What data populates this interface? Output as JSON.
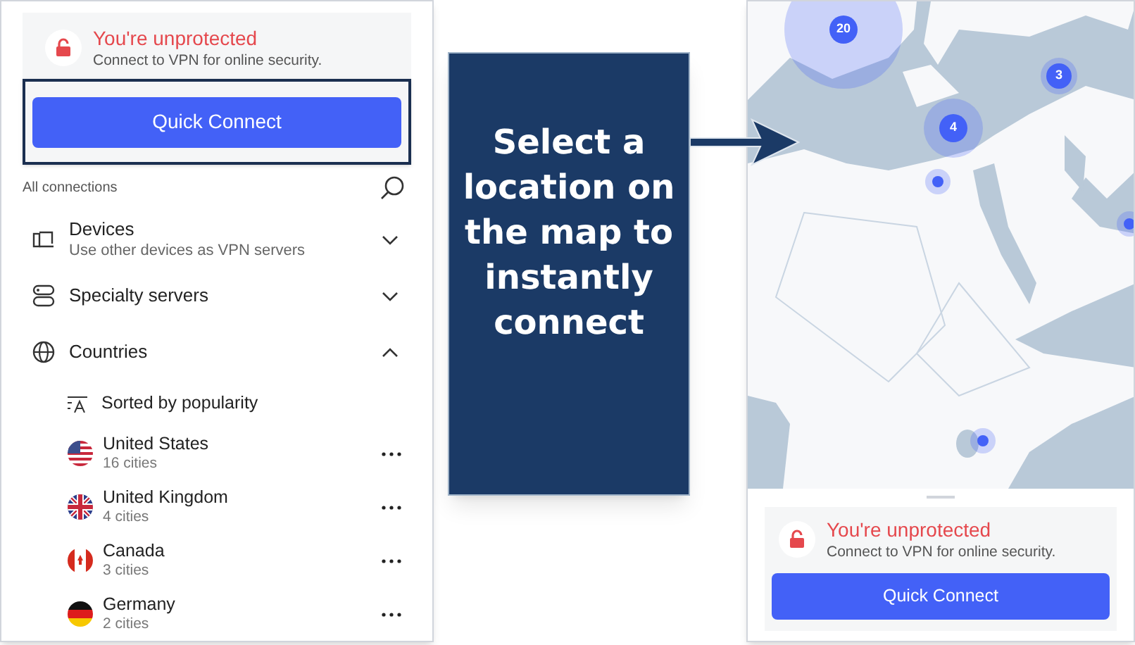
{
  "left_panel": {
    "status": {
      "title": "You're unprotected",
      "subtitle": "Connect to VPN for online security."
    },
    "quick_connect": {
      "label": "Quick Connect",
      "highlighted": true
    },
    "section_label": "All connections",
    "groups": [
      {
        "kind": "devices",
        "title": "Devices",
        "subtitle": "Use other devices as VPN servers",
        "expanded": false
      },
      {
        "kind": "specialty",
        "title": "Specialty servers",
        "expanded": false
      },
      {
        "kind": "countries",
        "title": "Countries",
        "expanded": true
      }
    ],
    "sort_label": "Sorted by popularity",
    "countries": [
      {
        "kind": "us",
        "name": "United States",
        "cities": "16 cities"
      },
      {
        "kind": "uk",
        "name": "United Kingdom",
        "cities": "4 cities"
      },
      {
        "kind": "ca",
        "name": "Canada",
        "cities": "3 cities"
      },
      {
        "kind": "de",
        "name": "Germany",
        "cities": "2 cities"
      }
    ]
  },
  "callout": {
    "text": "Select a location on the map to instantly connect"
  },
  "right_panel": {
    "markers": [
      {
        "kind": "cluster",
        "count": "20"
      },
      {
        "kind": "cluster",
        "count": "3"
      },
      {
        "kind": "cluster",
        "count": "4"
      },
      {
        "kind": "server"
      },
      {
        "kind": "server"
      },
      {
        "kind": "server"
      }
    ],
    "status": {
      "title": "You're unprotected",
      "subtitle": "Connect to VPN for online security."
    },
    "quick_connect": {
      "label": "Quick Connect"
    }
  }
}
